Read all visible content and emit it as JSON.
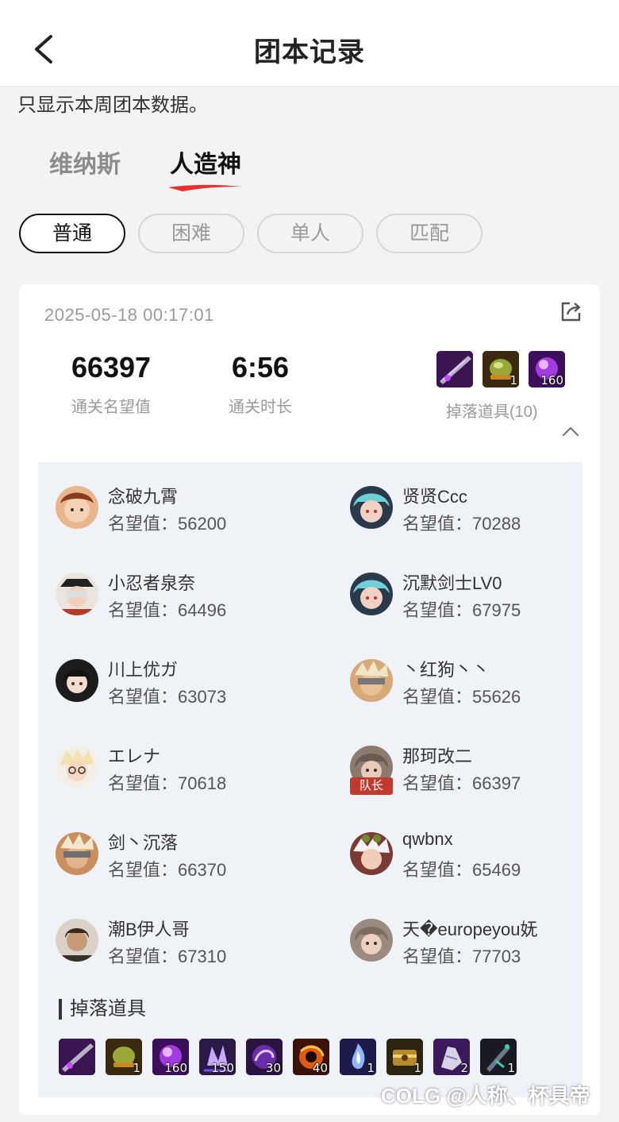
{
  "nav": {
    "title": "团本记录"
  },
  "notice": "只显示本周团本数据。",
  "tabs": [
    {
      "label": "维纳斯",
      "active": false
    },
    {
      "label": "人造神",
      "active": true
    }
  ],
  "filters": [
    {
      "label": "普通",
      "active": true
    },
    {
      "label": "困难",
      "active": false
    },
    {
      "label": "单人",
      "active": false
    },
    {
      "label": "匹配",
      "active": false
    }
  ],
  "record": {
    "datetime": "2025-05-18 00:17:01",
    "fame": {
      "value": "66397",
      "label": "通关名望值"
    },
    "duration": {
      "value": "6:56",
      "label": "通关时长"
    },
    "drops_label": "掉落道具(10)",
    "drops_preview": [
      {
        "icon": "weapon-item-icon",
        "qty": ""
      },
      {
        "icon": "green-orb-item-icon",
        "qty": "1"
      },
      {
        "icon": "purple-orb-item-icon",
        "qty": "160"
      }
    ],
    "members": [
      {
        "name": "念破九霄",
        "fame_label": "名望值：",
        "fame": "56200",
        "leader": false
      },
      {
        "name": "贤贤Ccc",
        "fame_label": "名望值：",
        "fame": "70288",
        "leader": false
      },
      {
        "name": "小忍者泉奈",
        "fame_label": "名望值：",
        "fame": "64496",
        "leader": false
      },
      {
        "name": "沉默剑士LV0",
        "fame_label": "名望值：",
        "fame": "67975",
        "leader": false
      },
      {
        "name": "川上优ガ",
        "fame_label": "名望值：",
        "fame": "63073",
        "leader": false
      },
      {
        "name": "丶红狗丶丶",
        "fame_label": "名望值：",
        "fame": "55626",
        "leader": false
      },
      {
        "name": "エレナ",
        "fame_label": "名望值：",
        "fame": "70618",
        "leader": false
      },
      {
        "name": "那珂改二",
        "fame_label": "名望值：",
        "fame": "66397",
        "leader": true,
        "leader_label": "队长"
      },
      {
        "name": "剑丶沉落",
        "fame_label": "名望值：",
        "fame": "66370",
        "leader": false
      },
      {
        "name": "qwbnx",
        "fame_label": "名望值：",
        "fame": "65469",
        "leader": false
      },
      {
        "name": "潮B伊人哥",
        "fame_label": "名望值：",
        "fame": "67310",
        "leader": false
      },
      {
        "name": "天�europeyou妩",
        "fame_label": "名望值：",
        "fame": "77703",
        "leader": false
      }
    ],
    "drops_title": "掉落道具",
    "drops": [
      {
        "icon": "weapon-item-icon",
        "qty": ""
      },
      {
        "icon": "green-orb-item-icon",
        "qty": "1"
      },
      {
        "icon": "purple-orb-item-icon",
        "qty": "160"
      },
      {
        "icon": "purple-crystal-item-icon",
        "qty": "150"
      },
      {
        "icon": "purple-swirl-item-icon",
        "qty": "30"
      },
      {
        "icon": "orange-swirl-item-icon",
        "qty": "40"
      },
      {
        "icon": "blue-flame-item-icon",
        "qty": "1"
      },
      {
        "icon": "gold-box-item-icon",
        "qty": "1"
      },
      {
        "icon": "gauntlet-item-icon",
        "qty": "2"
      },
      {
        "icon": "dark-blade-item-icon",
        "qty": "1"
      }
    ]
  },
  "watermark": "COLG @人称、杯具帝",
  "colors": {
    "accent": "#e8312d",
    "card_bg": "#ffffff",
    "inner_bg": "#eff2f7"
  }
}
